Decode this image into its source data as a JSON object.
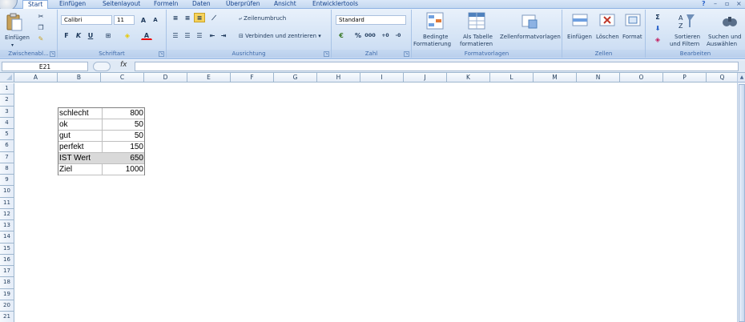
{
  "tabs": [
    "Start",
    "Einfügen",
    "Seitenlayout",
    "Formeln",
    "Daten",
    "Überprüfen",
    "Ansicht",
    "Entwicklertools"
  ],
  "active_tab": "Start",
  "window_controls": [
    "?",
    "–",
    "▫",
    "×"
  ],
  "ribbon": {
    "clipboard": {
      "paste_label": "Einfügen",
      "group_label": "Zwischenabl..."
    },
    "font": {
      "font_name": "Calibri",
      "font_size": "11",
      "group_label": "Schriftart",
      "bold": "F",
      "italic": "K",
      "underline": "U"
    },
    "alignment": {
      "wrap_label": "Zeilenumbruch",
      "merge_label": "Verbinden und zentrieren",
      "group_label": "Ausrichtung"
    },
    "number": {
      "format_value": "Standard",
      "percent": "%",
      "thousands": "000",
      "group_label": "Zahl"
    },
    "styles": {
      "conditional_line1": "Bedingte",
      "conditional_line2": "Formatierung",
      "table_line1": "Als Tabelle",
      "table_line2": "formatieren",
      "cellstyles_label": "Zellenformatvorlagen",
      "group_label": "Formatvorlagen"
    },
    "cells": {
      "insert_label": "Einfügen",
      "delete_label": "Löschen",
      "format_label": "Format",
      "group_label": "Zellen"
    },
    "editing": {
      "sort_line1": "Sortieren",
      "sort_line2": "und Filtern",
      "find_line1": "Suchen und",
      "find_line2": "Auswählen",
      "group_label": "Bearbeiten"
    }
  },
  "formula_bar": {
    "name_box": "E21",
    "fx": "fx",
    "formula": ""
  },
  "columns": [
    "A",
    "B",
    "C",
    "D",
    "E",
    "F",
    "G",
    "H",
    "I",
    "J",
    "K",
    "L",
    "M",
    "N",
    "O",
    "P",
    "Q"
  ],
  "rows": [
    "1",
    "2",
    "3",
    "4",
    "5",
    "6",
    "7",
    "8",
    "9",
    "10",
    "11",
    "12",
    "13",
    "14",
    "15",
    "16",
    "17",
    "18",
    "19",
    "20",
    "21"
  ],
  "table": [
    {
      "label": "schlecht",
      "value": "800",
      "highlight": false
    },
    {
      "label": "ok",
      "value": "50",
      "highlight": false
    },
    {
      "label": "gut",
      "value": "50",
      "highlight": false
    },
    {
      "label": "perfekt",
      "value": "150",
      "highlight": false
    },
    {
      "label": "IST Wert",
      "value": "650",
      "highlight": true
    },
    {
      "label": "Ziel",
      "value": "1000",
      "highlight": false
    }
  ],
  "colors": {
    "ribbon": "#d4e3f5",
    "header": "#e4ecf7",
    "highlight": "#d9d9d9"
  }
}
